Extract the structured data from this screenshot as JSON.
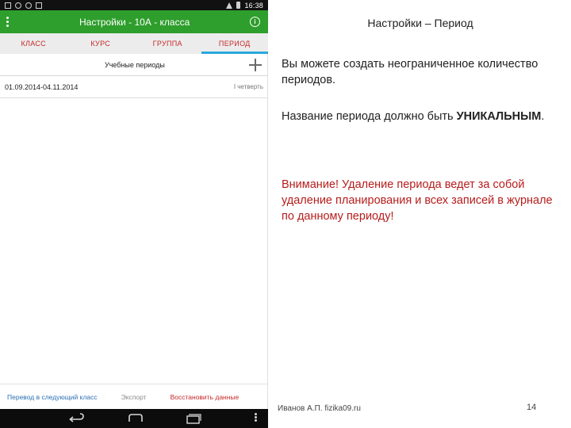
{
  "statusbar": {
    "time": "16:38"
  },
  "appbar": {
    "title": "Настройки - 10А - класса"
  },
  "tabs": [
    {
      "label": "КЛАСС"
    },
    {
      "label": "КУРС"
    },
    {
      "label": "ГРУППА"
    },
    {
      "label": "ПЕРИОД",
      "active": true
    }
  ],
  "periods_header": {
    "title": "Учебные периоды"
  },
  "periods": [
    {
      "dates": "01.09.2014-04.11.2014",
      "name": "I четверть"
    }
  ],
  "footer": {
    "transfer": "Перевод в следующий класс",
    "export": "Экспорт",
    "restore": "Восстановить данные"
  },
  "slide": {
    "title": "Настройки – Период",
    "p1": "Вы можете создать неограниченное количество периодов.",
    "p2_prefix": "Название периода должно быть ",
    "p2_strong": "УНИКАЛЬНЫМ",
    "p2_suffix": ".",
    "warning": "Внимание! Удаление периода ведет за собой удаление планирования и всех записей в журнале по данному периоду!",
    "author": "Иванов А.П. fizika09.ru",
    "page": "14"
  },
  "colors": {
    "appbar": "#2e9e2c",
    "tab_text": "#c62828",
    "tab_indicator": "#29a8de",
    "warning_text": "#b71c1c",
    "link_blue": "#2a6fb5"
  }
}
